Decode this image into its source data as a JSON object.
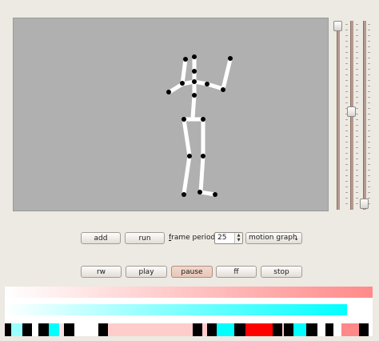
{
  "window": {
    "title": "",
    "background": "#ede9e3"
  },
  "canvas": {
    "background": "#b0b0b0",
    "figure_color": "#ffffff",
    "joint_color": "#000000"
  },
  "sliders": [
    {
      "name": "slider-1",
      "value": 1.0
    },
    {
      "name": "slider-2",
      "value": 0.47
    },
    {
      "name": "slider-3",
      "value": 0.0
    }
  ],
  "controls": {
    "add_label": "add",
    "run_label": "run",
    "frame_period_label": "frame period:",
    "frame_period_mnemonic": "f",
    "frame_period_rest": "rame period:",
    "frame_period_value": "25",
    "mode_value": "motion graph",
    "spin_up_icon": "▲",
    "spin_down_icon": "▼",
    "chevron_icon": "⌄"
  },
  "transport": {
    "rw_label": "rw",
    "play_label": "play",
    "pause_label": "pause",
    "ff_label": "ff",
    "stop_label": "stop",
    "active": "pause"
  },
  "timeline": {
    "row1": {
      "start": "#ffffff",
      "end": "#ff8a8a"
    },
    "row2": {
      "start": "#ffffff",
      "end": "#00ffff",
      "fill": 0.93
    },
    "row3_colors": [
      "#000000",
      "#00ffff",
      "#ff0000",
      "#ffb3b3"
    ]
  }
}
